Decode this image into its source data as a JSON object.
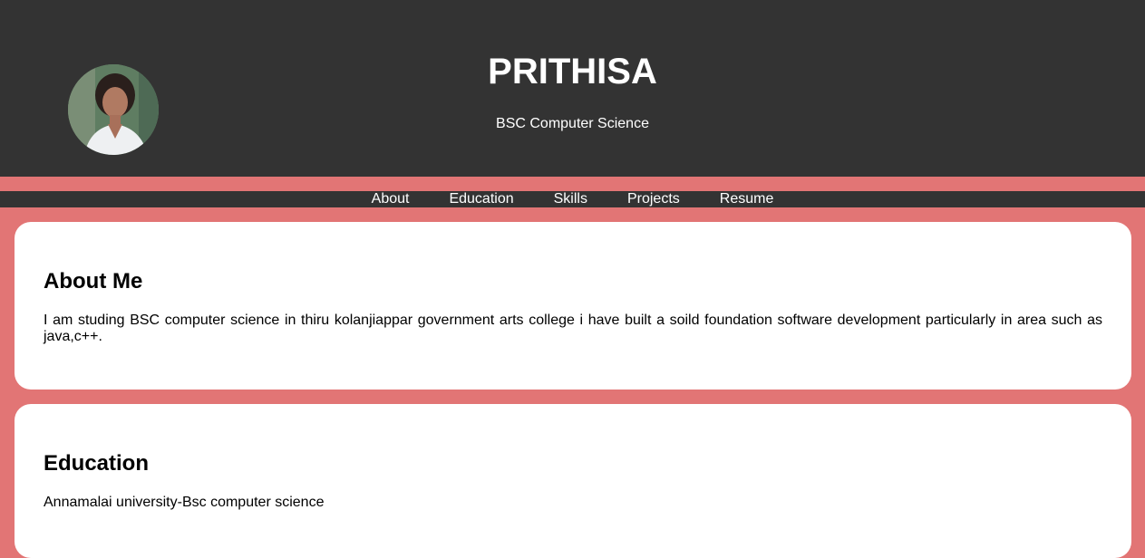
{
  "header": {
    "name": "PRITHISA",
    "subtitle": "BSC Computer Science"
  },
  "nav": {
    "items": [
      "About",
      "Education",
      "Skills",
      "Projects",
      "Resume"
    ]
  },
  "about": {
    "heading": "About Me",
    "text": "I am studing BSC computer science in thiru kolanjiappar government arts college i have built a soild foundation software development particularly in area such as java,c++."
  },
  "education": {
    "heading": "Education",
    "text": "Annamalai university-Bsc computer science"
  },
  "colors": {
    "header_bg": "#333333",
    "page_bg": "#e27575",
    "card_bg": "#ffffff"
  }
}
